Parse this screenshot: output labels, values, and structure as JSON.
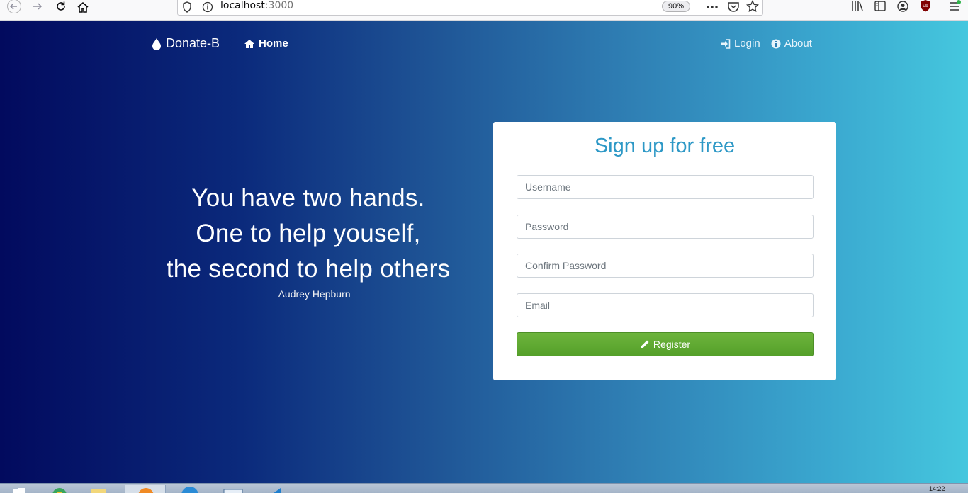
{
  "browser": {
    "url_host": "localhost",
    "url_port": ":3000",
    "zoom": "90%",
    "icons": [
      "back-icon",
      "forward-icon",
      "reload-icon",
      "home-icon",
      "shield-icon",
      "info-icon",
      "more-icon",
      "pocket-icon",
      "star-icon",
      "library-icon",
      "sidebar-icon",
      "account-icon",
      "ublock-icon",
      "menu-icon"
    ]
  },
  "navbar": {
    "brand": "Donate-B",
    "home": "Home",
    "login": "Login",
    "about": "About"
  },
  "quote": {
    "line1": "You have two hands.",
    "line2": "One to help youself,",
    "line3": "the second to help others",
    "author": "— Audrey Hepburn"
  },
  "signup": {
    "title": "Sign up for free",
    "username_placeholder": "Username",
    "password_placeholder": "Password",
    "confirm_placeholder": "Confirm Password",
    "email_placeholder": "Email",
    "register_label": "Register"
  },
  "taskbar": {
    "clock": "14:22"
  },
  "colors": {
    "gradient_start": "#020a5e",
    "gradient_end": "#45c7de",
    "title_accent": "#2d98c6",
    "register_green": "#5fa832"
  }
}
